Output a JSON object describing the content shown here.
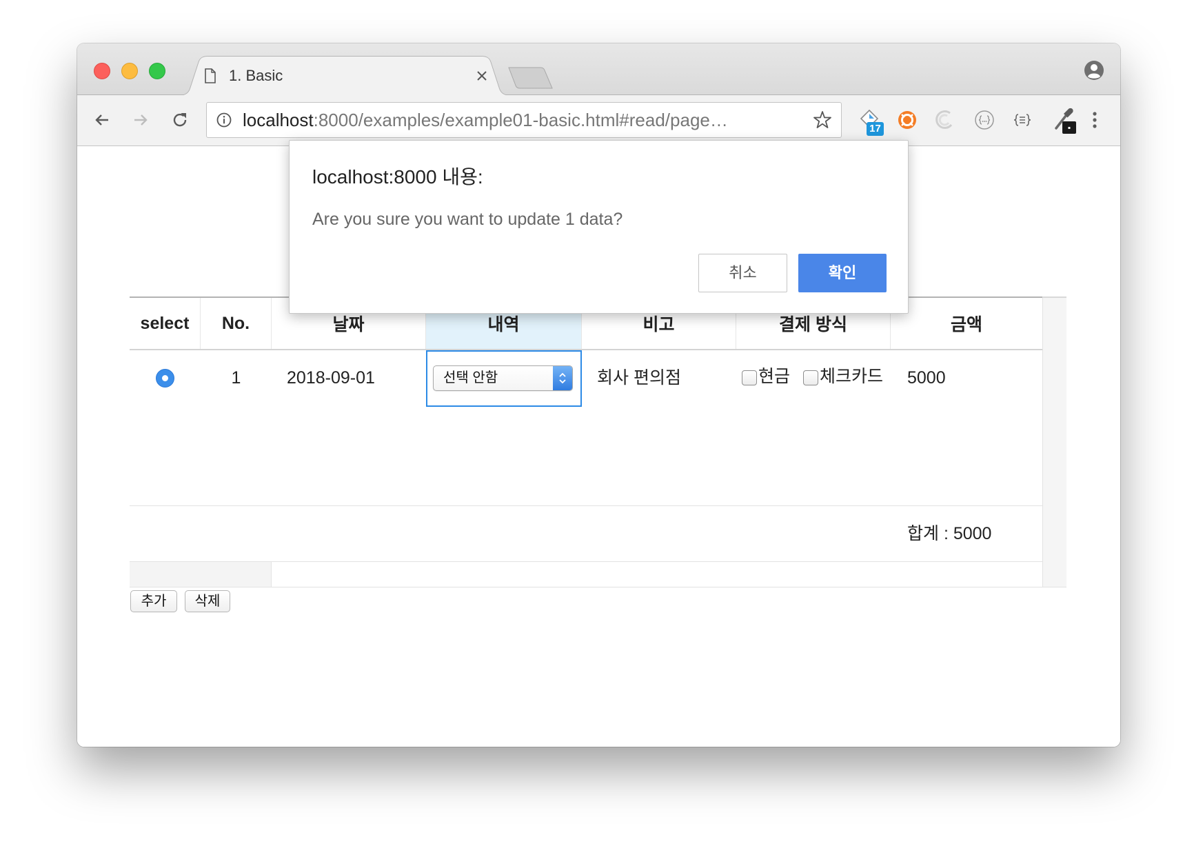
{
  "browser": {
    "tab": {
      "title": "1. Basic"
    },
    "address": {
      "host": "localhost",
      "rest": ":8000/examples/example01-basic.html#read/page…"
    },
    "extensions": {
      "badge_count": "17"
    },
    "icons": [
      "page-icon",
      "close-icon",
      "new-tab-icon",
      "profile-icon",
      "back-arrow-icon",
      "forward-arrow-icon",
      "reload-icon",
      "info-icon",
      "star-icon",
      "extension-badge-icon",
      "extension-orange-icon",
      "extension-swirl-icon",
      "extension-json-icon",
      "extension-format-icon",
      "extension-dropper-icon",
      "menu-dots-icon"
    ]
  },
  "dialog": {
    "title": "localhost:8000 내용:",
    "message": "Are you sure you want to update 1 data?",
    "cancel_label": "취소",
    "ok_label": "확인"
  },
  "table": {
    "columns": [
      "select",
      "No.",
      "날짜",
      "내역",
      "비고",
      "결제 방식",
      "금액"
    ],
    "rows": [
      {
        "selected": true,
        "no": "1",
        "date": "2018-09-01",
        "category": "선택 안함",
        "memo": "회사 편의점",
        "payment": [
          {
            "label": "현금",
            "checked": false
          },
          {
            "label": "체크카드",
            "checked": false
          }
        ],
        "amount": "5000"
      }
    ],
    "footer_total": "합계 : 5000"
  },
  "actions": {
    "add_label": "추가",
    "delete_label": "삭제"
  },
  "colors": {
    "accent": "#4a86e8",
    "radio": "#3b8eea",
    "focus_border": "#2c8ae6",
    "header_highlight": "#e2f2fb",
    "badge": "#1e96dc"
  }
}
